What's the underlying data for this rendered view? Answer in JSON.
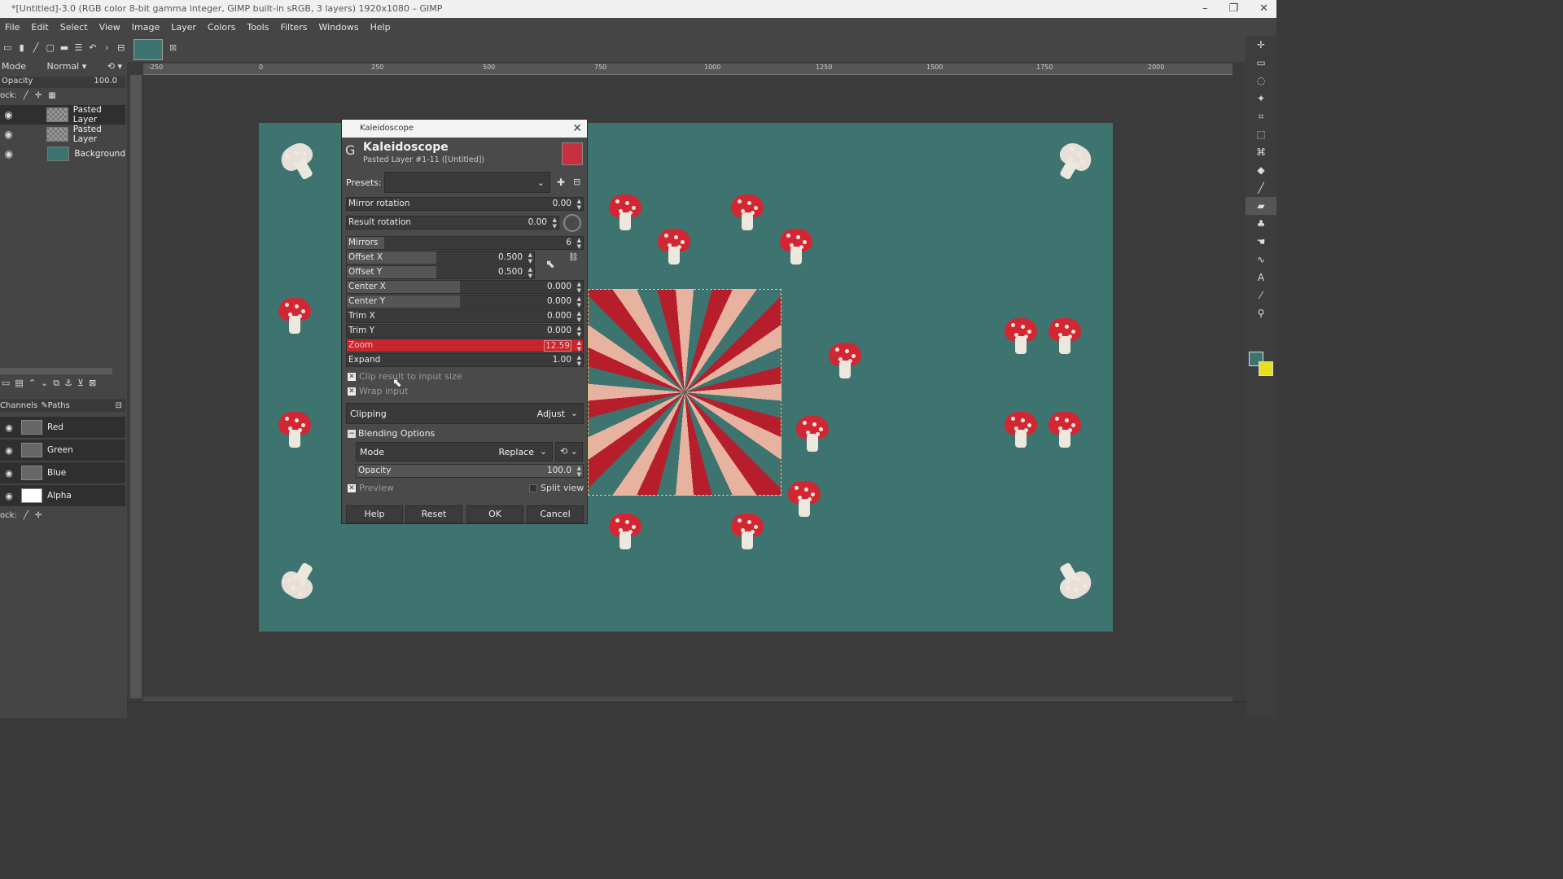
{
  "window": {
    "title": "*[Untitled]-3.0 (RGB color 8-bit gamma integer, GIMP built-in sRGB, 3 layers) 1920x1080 – GIMP"
  },
  "menu": [
    "File",
    "Edit",
    "Select",
    "View",
    "Image",
    "Layer",
    "Colors",
    "Tools",
    "Filters",
    "Windows",
    "Help"
  ],
  "layers_panel": {
    "mode_label": "Mode",
    "mode_value": "Normal",
    "opacity_label": "Opacity",
    "opacity_value": "100.0",
    "lock_label": "ock:",
    "layers": [
      {
        "name": "Pasted Layer"
      },
      {
        "name": "Pasted Layer"
      },
      {
        "name": "Background"
      }
    ]
  },
  "channels_panel": {
    "tab_channels": "Channels",
    "tab_paths": "Paths",
    "channels": [
      "Red",
      "Green",
      "Blue",
      "Alpha"
    ],
    "lock_label": "ock:"
  },
  "ruler": {
    "ticks": [
      "-250",
      "0",
      "250",
      "500",
      "750",
      "1000",
      "1250",
      "1500",
      "1750",
      "2000"
    ]
  },
  "dialog": {
    "window_title": "Kaleidoscope",
    "heading": "Kaleidoscope",
    "subheading": "Pasted Layer #1-11 ([Untitled])",
    "presets_label": "Presets:",
    "params": [
      {
        "label": "Mirror rotation",
        "value": "0.00"
      },
      {
        "label": "Result rotation",
        "value": "0.00"
      },
      {
        "label": "Mirrors",
        "value": "6"
      },
      {
        "label": "Offset X",
        "value": "0.500"
      },
      {
        "label": "Offset Y",
        "value": "0.500"
      },
      {
        "label": "Center X",
        "value": "0.000"
      },
      {
        "label": "Center Y",
        "value": "0.000"
      },
      {
        "label": "Trim X",
        "value": "0.000"
      },
      {
        "label": "Trim Y",
        "value": "0.000"
      },
      {
        "label": "Zoom",
        "value": "12.59"
      },
      {
        "label": "Expand",
        "value": "1.00"
      }
    ],
    "clip_result": "Clip result to input size",
    "wrap_input": "Wrap input",
    "clipping_label": "Clipping",
    "clipping_value": "Adjust",
    "blending_label": "Blending Options",
    "mode_label": "Mode",
    "mode_value": "Replace",
    "opacity_label": "Opacity",
    "opacity_value": "100.0",
    "preview_label": "Preview",
    "split_view_label": "Split view",
    "buttons": {
      "help": "Help",
      "reset": "Reset",
      "ok": "OK",
      "cancel": "Cancel"
    }
  },
  "colors": {
    "canvas_bg": "#3e7470",
    "zoom_highlight": "#c8262e",
    "mushroom_red": "#d22632"
  }
}
